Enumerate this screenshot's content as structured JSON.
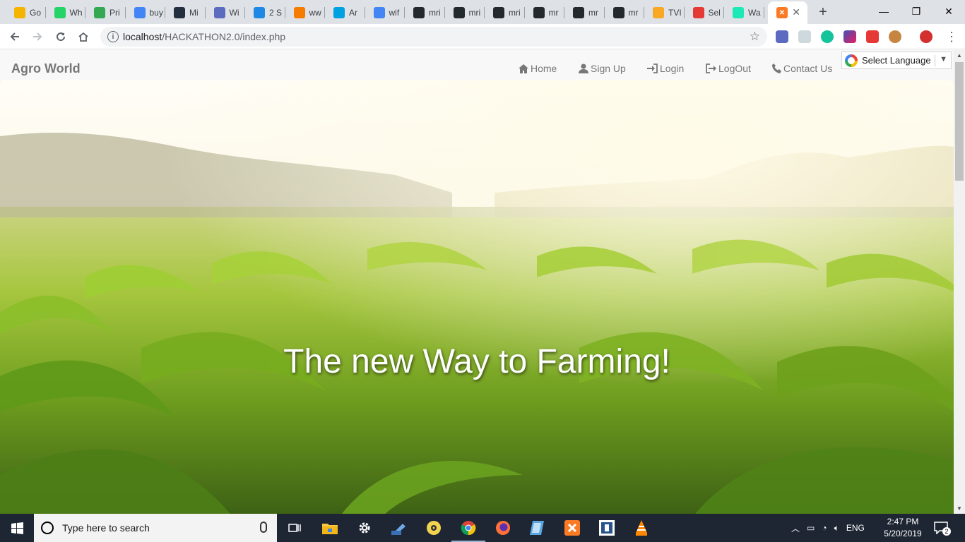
{
  "browser": {
    "tabs": [
      {
        "label": "Go",
        "icon": "bulb-icon",
        "color": "#f4b400"
      },
      {
        "label": "Wh",
        "icon": "whatsapp-icon",
        "color": "#25d366"
      },
      {
        "label": "Pri",
        "icon": "play-icon",
        "color": "#34a853"
      },
      {
        "label": "buy",
        "icon": "google-icon",
        "color": "#4285f4"
      },
      {
        "label": "Mi",
        "icon": "amazon-icon",
        "color": "#232f3e"
      },
      {
        "label": "Wi",
        "icon": "shield-icon",
        "color": "#5c6bc0"
      },
      {
        "label": "2 S",
        "icon": "chat-icon",
        "color": "#1e88e5"
      },
      {
        "label": "ww",
        "icon": "w-icon",
        "color": "#f57c00"
      },
      {
        "label": "Ar",
        "icon": "cloud-icon",
        "color": "#00a1e0"
      },
      {
        "label": "wif",
        "icon": "google-icon",
        "color": "#4285f4"
      },
      {
        "label": "mri",
        "icon": "github-icon",
        "color": "#24292e"
      },
      {
        "label": "mri",
        "icon": "github-icon",
        "color": "#24292e"
      },
      {
        "label": "mri",
        "icon": "github-icon",
        "color": "#24292e"
      },
      {
        "label": "mr",
        "icon": "github-icon",
        "color": "#24292e"
      },
      {
        "label": "mr",
        "icon": "github-icon",
        "color": "#24292e"
      },
      {
        "label": "mr",
        "icon": "github-icon",
        "color": "#24292e"
      },
      {
        "label": "TVI",
        "icon": "tv-icon",
        "color": "#f9a825"
      },
      {
        "label": "Sel",
        "icon": "heart-icon",
        "color": "#e53935"
      },
      {
        "label": "Wa",
        "icon": "play-icon",
        "color": "#1de9b6"
      }
    ],
    "active_tab_icon": "xampp-icon",
    "url_host": "localhost",
    "url_path": "/HACKATHON2.0/index.php",
    "window_controls": {
      "minimize": "—",
      "maximize": "❐",
      "close": "✕"
    }
  },
  "site": {
    "brand": "Agro World",
    "nav": [
      {
        "label": "Home",
        "icon": "home-icon"
      },
      {
        "label": "Sign Up",
        "icon": "user-icon"
      },
      {
        "label": "Login",
        "icon": "login-icon"
      },
      {
        "label": "LogOut",
        "icon": "logout-icon"
      },
      {
        "label": "Contact Us",
        "icon": "phone-icon"
      }
    ],
    "translate_label": "Select Language",
    "hero_title": "The new Way to Farming!"
  },
  "taskbar": {
    "search_placeholder": "Type here to search",
    "language": "ENG",
    "time": "2:47 PM",
    "date": "5/20/2019",
    "notification_count": "2"
  }
}
